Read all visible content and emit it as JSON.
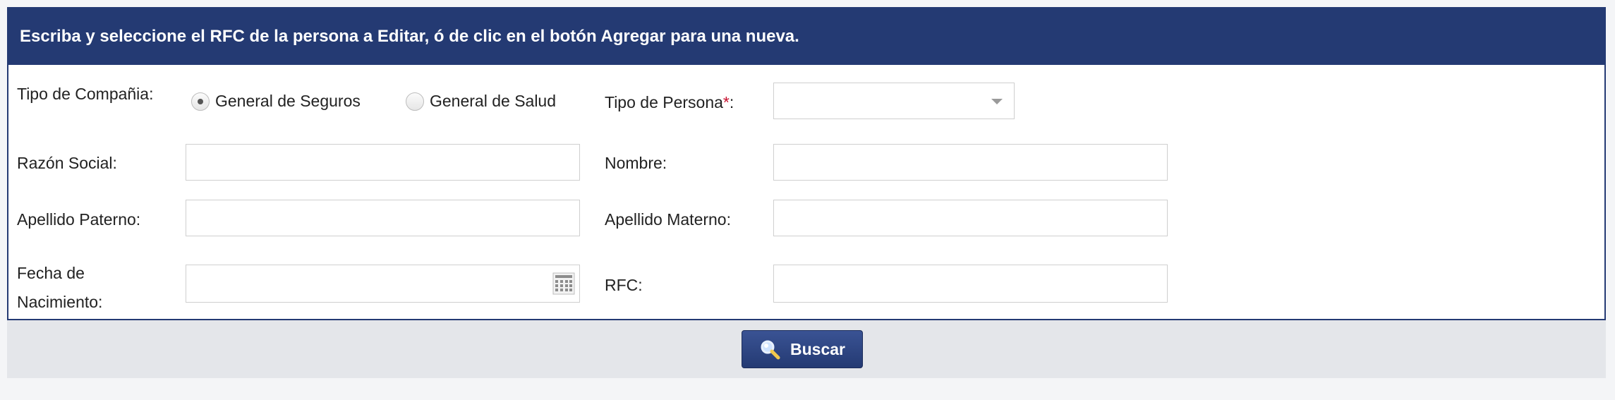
{
  "header": {
    "text": "Escriba y seleccione el RFC de la persona a Editar, ó de clic en el botón Agregar para una nueva."
  },
  "form": {
    "tipo_compania": {
      "label": "Tipo de Compañia:",
      "options": [
        {
          "label": "General de Seguros",
          "selected": true
        },
        {
          "label": "General de Salud",
          "selected": false
        }
      ]
    },
    "tipo_persona": {
      "label": "Tipo de Persona",
      "required_mark": "*",
      "suffix": ":",
      "value": ""
    },
    "razon_social": {
      "label": "Razón Social:",
      "value": ""
    },
    "nombre": {
      "label": "Nombre:",
      "value": ""
    },
    "apellido_paterno": {
      "label": "Apellido Paterno:",
      "value": ""
    },
    "apellido_materno": {
      "label": "Apellido Materno:",
      "value": ""
    },
    "fecha_nacimiento": {
      "label_line1": "Fecha de",
      "label_line2": "Nacimiento:",
      "value": "",
      "icon": "calendar-icon"
    },
    "rfc": {
      "label": "RFC:",
      "value": ""
    }
  },
  "actions": {
    "buscar": {
      "label": "Buscar",
      "icon": "search-icon"
    }
  },
  "colors": {
    "header_bg": "#243a73",
    "required": "#c8102e",
    "footer_bg": "#e4e6ea"
  }
}
